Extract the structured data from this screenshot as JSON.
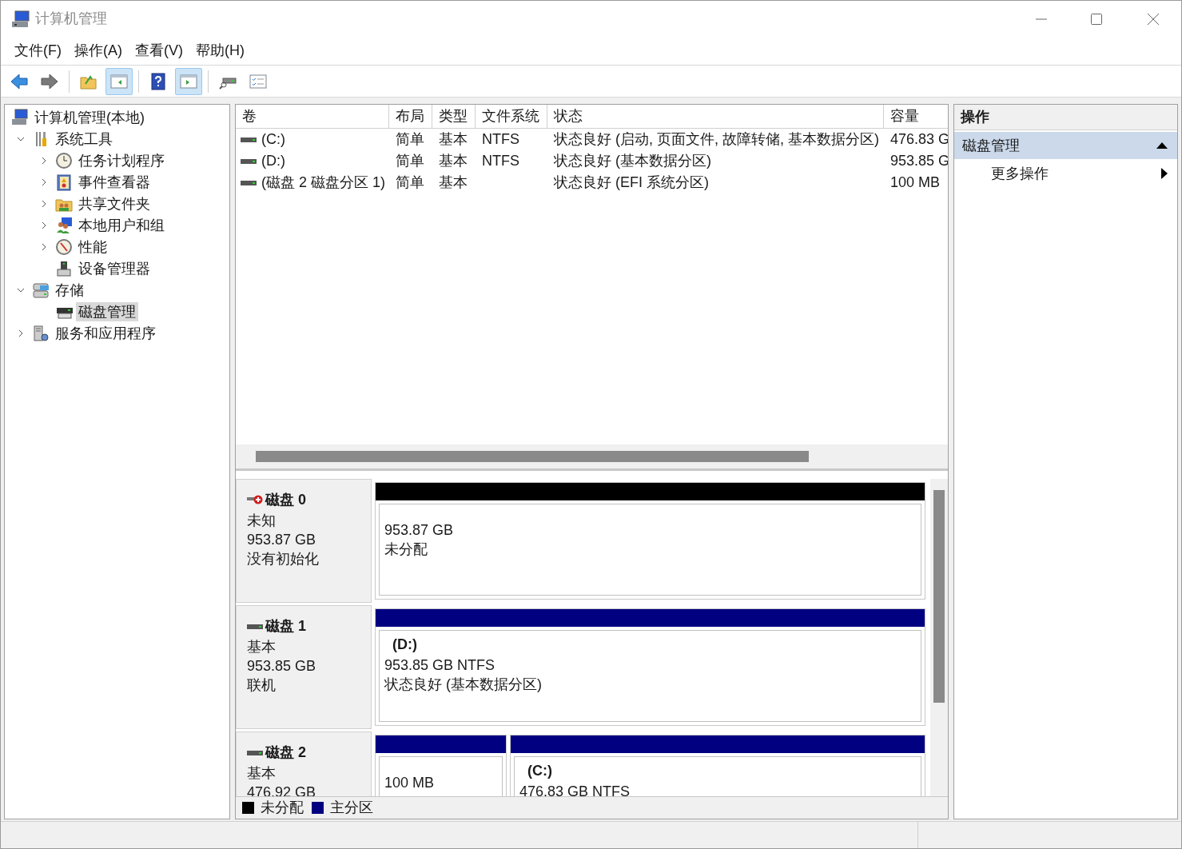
{
  "window": {
    "title": "计算机管理"
  },
  "menu": [
    "文件(F)",
    "操作(A)",
    "查看(V)",
    "帮助(H)"
  ],
  "toolbar": [
    {
      "buttons": [
        {
          "kind": "back",
          "pressed": false
        },
        {
          "kind": "forward",
          "pressed": false
        }
      ]
    },
    {
      "buttons": [
        {
          "kind": "up",
          "pressed": false
        },
        {
          "kind": "tree-pane",
          "pressed": true
        }
      ]
    },
    {
      "buttons": [
        {
          "kind": "help",
          "pressed": false
        },
        {
          "kind": "action-pane",
          "pressed": true
        }
      ]
    },
    {
      "buttons": [
        {
          "kind": "connect",
          "pressed": false
        },
        {
          "kind": "properties",
          "pressed": false
        }
      ]
    }
  ],
  "tree": [
    {
      "label": "计算机管理(本地)",
      "kind": "computer",
      "selected": false,
      "children": [
        {
          "label": "系统工具",
          "kind": "tools",
          "selected": false,
          "expanded": true,
          "children": [
            {
              "label": "任务计划程序",
              "kind": "clock",
              "selected": false,
              "expanded": false
            },
            {
              "label": "事件查看器",
              "kind": "event",
              "selected": false,
              "expanded": false
            },
            {
              "label": "共享文件夹",
              "kind": "share",
              "selected": false,
              "expanded": false
            },
            {
              "label": "本地用户和组",
              "kind": "users",
              "selected": false,
              "expanded": false
            },
            {
              "label": "性能",
              "kind": "perf",
              "selected": false,
              "expanded": false
            },
            {
              "label": "设备管理器",
              "kind": "device",
              "selected": false
            }
          ]
        },
        {
          "label": "存储",
          "kind": "storage",
          "selected": false,
          "expanded": true,
          "children": [
            {
              "label": "磁盘管理",
              "kind": "disk",
              "selected": true
            }
          ]
        },
        {
          "label": "服务和应用程序",
          "kind": "services",
          "selected": false,
          "expanded": false
        }
      ]
    }
  ],
  "volumes": {
    "columns": [
      "卷",
      "布局",
      "类型",
      "文件系统",
      "状态",
      "容量"
    ],
    "rows": [
      [
        "(C:)",
        "简单",
        "基本",
        "NTFS",
        "状态良好 (启动, 页面文件, 故障转储, 基本数据分区)",
        "476.83 G"
      ],
      [
        "(D:)",
        "简单",
        "基本",
        "NTFS",
        "状态良好 (基本数据分区)",
        "953.85 G"
      ],
      [
        "(磁盘 2 磁盘分区 1)",
        "简单",
        "基本",
        "",
        "状态良好 (EFI 系统分区)",
        "100 MB"
      ]
    ]
  },
  "disks": [
    {
      "name": "磁盘 0",
      "error": true,
      "type": "未知",
      "size": "953.87 GB",
      "status": "没有初始化",
      "partitions": [
        {
          "kind": "unallocated",
          "lines": [
            "953.87 GB",
            "未分配"
          ]
        }
      ]
    },
    {
      "name": "磁盘 1",
      "error": false,
      "type": "基本",
      "size": "953.85 GB",
      "status": "联机",
      "partitions": [
        {
          "kind": "primary",
          "drive": "(D:)",
          "lines": [
            "953.85 GB NTFS",
            "状态良好 (基本数据分区)"
          ]
        }
      ]
    },
    {
      "name": "磁盘 2",
      "error": false,
      "type": "基本",
      "size": "476.92 GB",
      "partitions": [
        {
          "kind": "primary",
          "lines": [
            "100 MB"
          ]
        },
        {
          "kind": "primary",
          "drive": "(C:)",
          "lines": [
            "476.83 GB NTFS"
          ]
        }
      ]
    }
  ],
  "legend": [
    {
      "label": "未分配",
      "color": "#000000"
    },
    {
      "label": "主分区",
      "color": "#000080"
    }
  ],
  "actions": {
    "title": "操作",
    "sections": [
      {
        "label": "磁盘管理",
        "expanded": true,
        "items": [
          "更多操作"
        ]
      }
    ]
  }
}
